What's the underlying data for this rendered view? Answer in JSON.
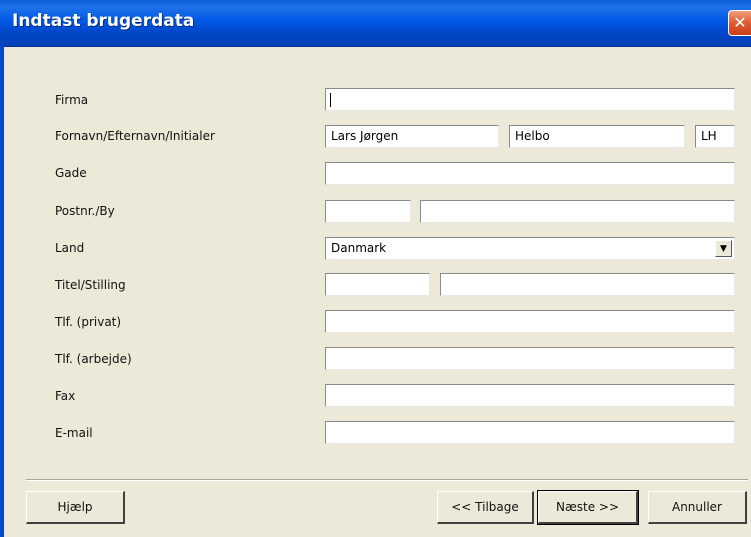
{
  "window": {
    "title": "Indtast brugerdata",
    "close_glyph": "✕"
  },
  "form": {
    "firma": {
      "label": "Firma",
      "value": ""
    },
    "navn": {
      "label": "Fornavn/Efternavn/Initialer",
      "fornavn": "Lars Jørgen",
      "efternavn": "Helbo",
      "initialer": "LH"
    },
    "gade": {
      "label": "Gade",
      "value": ""
    },
    "postnr_by": {
      "label": "Postnr./By",
      "postnr": "",
      "by": ""
    },
    "land": {
      "label": "Land",
      "value": "Danmark",
      "arrow": "▼"
    },
    "titel_stilling": {
      "label": "Titel/Stilling",
      "titel": "",
      "stilling": ""
    },
    "tlf_privat": {
      "label": "Tlf. (privat)",
      "value": ""
    },
    "tlf_arbejde": {
      "label": "Tlf. (arbejde)",
      "value": ""
    },
    "fax": {
      "label": "Fax",
      "value": ""
    },
    "email": {
      "label": "E-mail",
      "value": ""
    }
  },
  "buttons": {
    "help": "Hjælp",
    "back": "<< Tilbage",
    "next": "Næste >>",
    "cancel": "Annuller"
  }
}
